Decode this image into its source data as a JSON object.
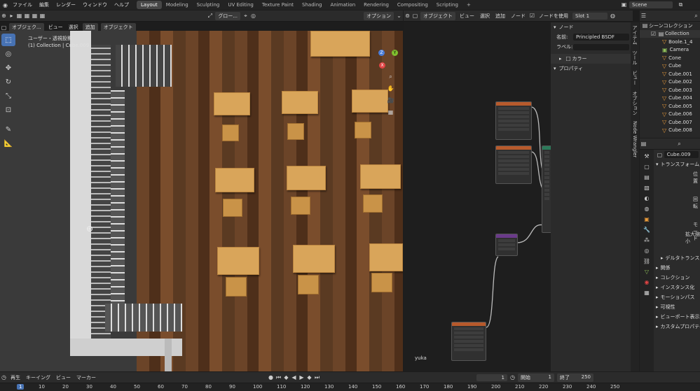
{
  "topbar": {
    "menus": [
      "ファイル",
      "編集",
      "レンダー",
      "ウィンドウ",
      "ヘルプ"
    ],
    "workspaces": [
      "Layout",
      "Modeling",
      "Sculpting",
      "UV Editing",
      "Texture Paint",
      "Shading",
      "Animation",
      "Rendering",
      "Compositing",
      "Scripting"
    ],
    "active_workspace": "Layout",
    "add_tab": "+",
    "scene": "Scene"
  },
  "viewport": {
    "mode": "オブジェク...",
    "menus": [
      "ビュー",
      "選択",
      "追加",
      "オブジェクト"
    ],
    "transform": "グロー...",
    "option": "オプション",
    "overlay_line1": "ユーザー・透視投影",
    "overlay_line2": "(1) Collection | Cube.009",
    "gizmo": {
      "x": "X",
      "y": "Y",
      "z": "Z"
    }
  },
  "node_editor": {
    "type": "オブジェクト",
    "menus": [
      "ビュー",
      "選択",
      "追加",
      "ノード"
    ],
    "use_nodes": "ノードを使用",
    "slot": "Slot 1",
    "material_label": "yuka",
    "panel": {
      "section_node": "ノード",
      "name_label": "名前:",
      "name_value": "Principled BSDF",
      "label_label": "ラベル:",
      "color_label": "カラー",
      "properties": "プロパティ"
    },
    "side_tabs": [
      "アイテム",
      "ツール",
      "ビュー",
      "オプション",
      "Node Wrangler"
    ]
  },
  "outliner": {
    "header": "シーンコレクション",
    "collection": "Collection",
    "items": [
      "Boole.1_4",
      "Camera",
      "Cone",
      "Cube",
      "Cube.001",
      "Cube.002",
      "Cube.003",
      "Cube.004",
      "Cube.005",
      "Cube.006",
      "Cube.007",
      "Cube.008"
    ]
  },
  "properties": {
    "object": "Cube.009",
    "sections": [
      "トランスフォーム",
      "デルタトランスフォーム",
      "関係",
      "コレクション",
      "インスタンス化",
      "モーションパス",
      "可視性",
      "ビューポート表示",
      "カスタムプロパティ"
    ],
    "fields": [
      "位置",
      "回転",
      "モード",
      "拡大縮小"
    ]
  },
  "timeline": {
    "menus": [
      "再生",
      "キーイング",
      "ビュー",
      "マーカー"
    ],
    "current": "1",
    "start_label": "開始",
    "start": "1",
    "end_label": "終了",
    "end": "250",
    "ruler": [
      "1",
      "10",
      "20",
      "30",
      "40",
      "50",
      "60",
      "70",
      "80",
      "90",
      "100",
      "110",
      "120",
      "130",
      "140",
      "150",
      "160",
      "170",
      "180",
      "190",
      "200",
      "210",
      "220",
      "230",
      "240",
      "250"
    ]
  },
  "colors": {
    "accent": "#4772b3",
    "node_header": "#b75a2c",
    "floor": "#5a3a22",
    "desk": "#d9a55a"
  }
}
